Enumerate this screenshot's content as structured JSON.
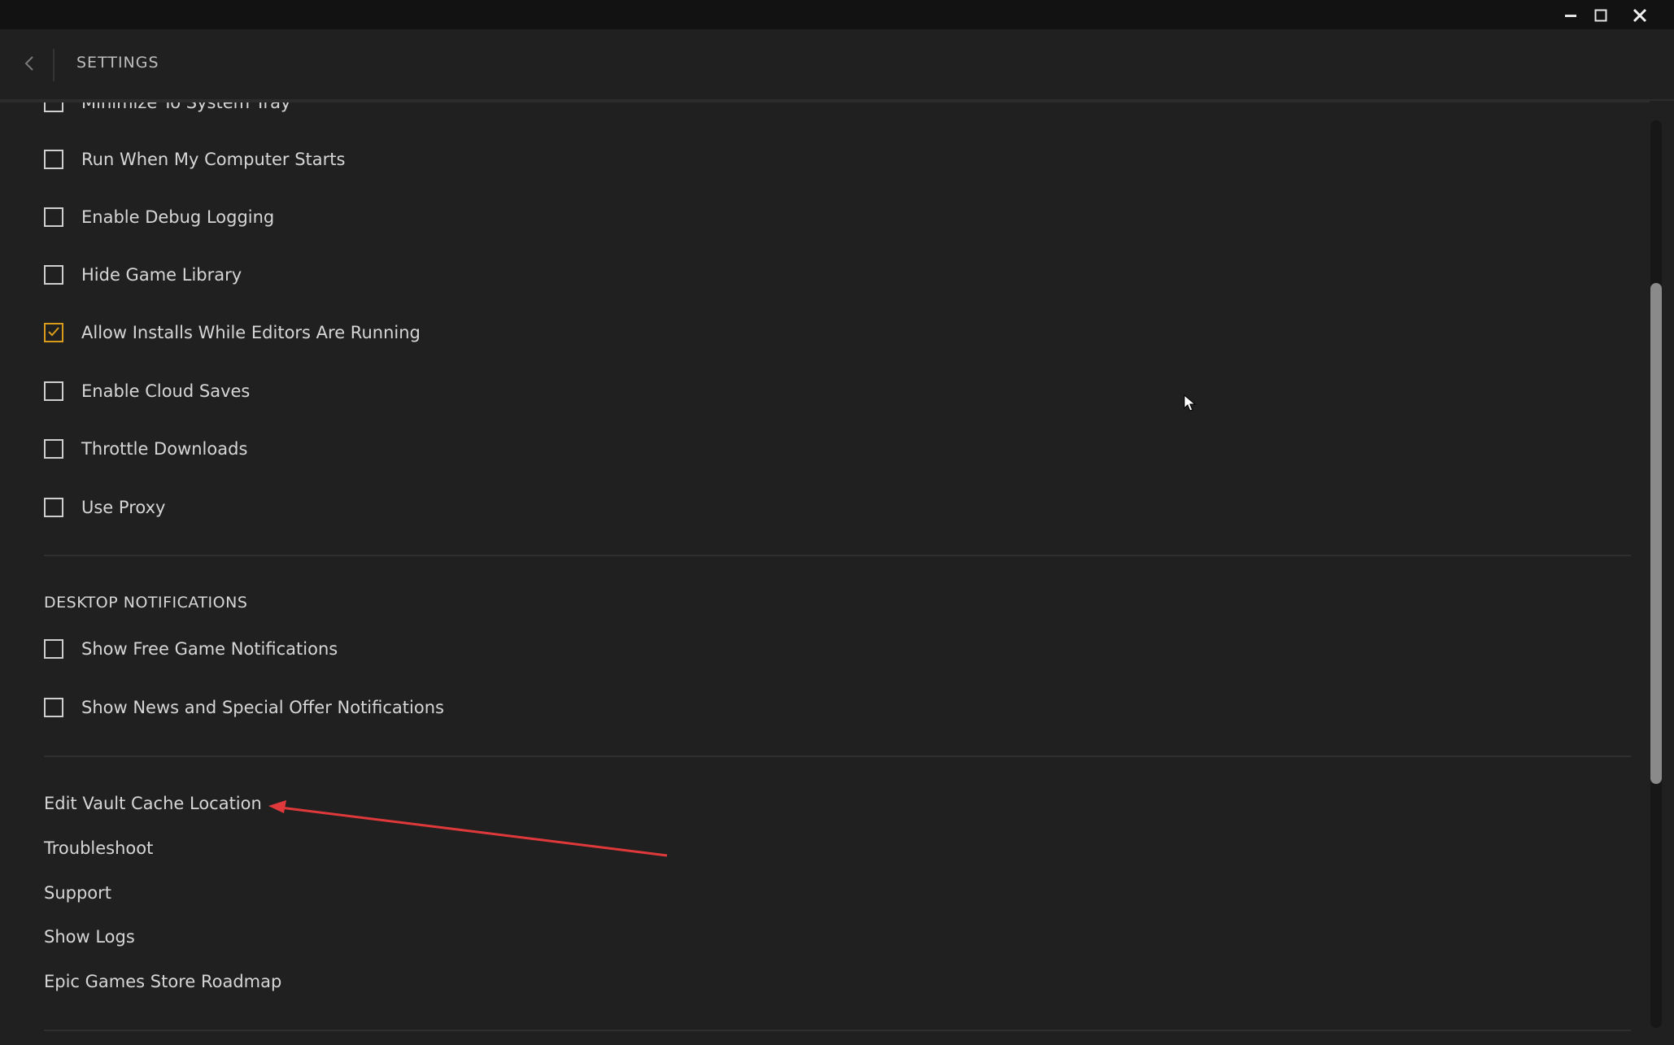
{
  "window_controls": {
    "minimize_icon": "minimize-icon",
    "maximize_icon": "maximize-icon",
    "close_icon": "close-icon"
  },
  "header": {
    "back_icon": "chevron-left-icon",
    "title": "SETTINGS"
  },
  "general_options": [
    {
      "label": "Minimize To System Tray",
      "checked": false
    },
    {
      "label": "Run When My Computer Starts",
      "checked": false
    },
    {
      "label": "Enable Debug Logging",
      "checked": false
    },
    {
      "label": "Hide Game Library",
      "checked": false
    },
    {
      "label": "Allow Installs While Editors Are Running",
      "checked": true
    },
    {
      "label": "Enable Cloud Saves",
      "checked": false
    },
    {
      "label": "Throttle Downloads",
      "checked": false
    },
    {
      "label": "Use Proxy",
      "checked": false
    }
  ],
  "desktop_notifications": {
    "heading": "DESKTOP NOTIFICATIONS",
    "options": [
      {
        "label": "Show Free Game Notifications",
        "checked": false
      },
      {
        "label": "Show News and Special Offer Notifications",
        "checked": false
      }
    ]
  },
  "links": [
    {
      "label": "Edit Vault Cache Location"
    },
    {
      "label": "Troubleshoot"
    },
    {
      "label": "Support"
    },
    {
      "label": "Show Logs"
    },
    {
      "label": "Epic Games Store Roadmap"
    }
  ],
  "colors": {
    "checkbox_checked": "#d89b1a",
    "annotation_arrow": "#e0393b",
    "background": "#202020"
  }
}
